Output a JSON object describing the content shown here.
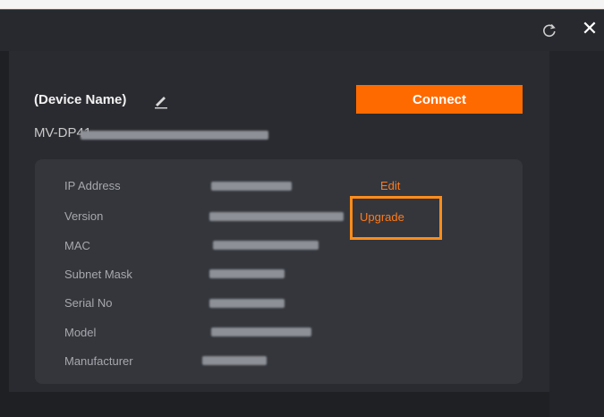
{
  "window": {
    "refresh_icon": "refresh-icon",
    "close_icon": "close-icon",
    "close_glyph": "✕"
  },
  "device": {
    "name": "(Device Name)",
    "id_prefix": "MV-DP41",
    "connect_label": "Connect"
  },
  "info": {
    "labels": [
      "IP Address",
      "Version",
      "MAC",
      "Subnet Mask",
      "Serial No",
      "Model",
      "Manufacturer"
    ],
    "edit_label": "Edit",
    "upgrade_label": "Upgrade"
  },
  "colors": {
    "accent": "#ff6a00",
    "link": "#ff7a1a",
    "highlight": "#ff8c1a",
    "background": "#1f2024",
    "info_box": "#34363c"
  }
}
